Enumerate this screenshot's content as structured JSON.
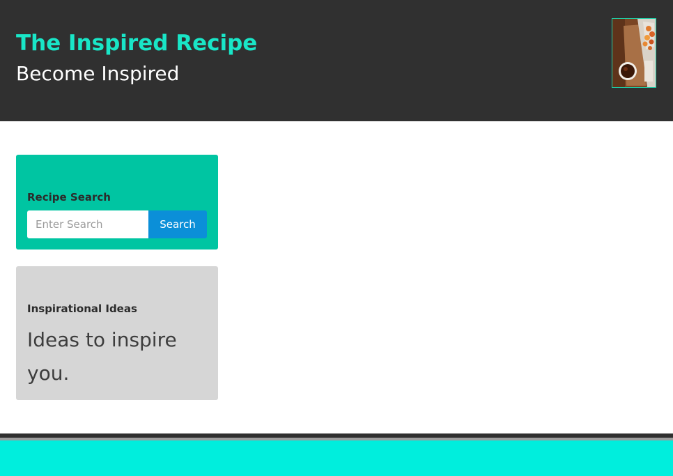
{
  "header": {
    "title": "The Inspired Recipe",
    "subtitle": "Become Inspired",
    "logo_icon": "food-photo-logo"
  },
  "search_panel": {
    "heading": "Recipe Search",
    "input_placeholder": "Enter Search",
    "input_value": "",
    "button_label": "Search"
  },
  "ideas_panel": {
    "heading": "Inspirational Ideas",
    "body": "Ideas to inspire you."
  },
  "colors": {
    "header_bg": "#303030",
    "title_accent": "#19e6c7",
    "search_panel_bg": "#00c5a2",
    "search_button_bg": "#0b8fd8",
    "ideas_panel_bg": "#d6d6d6",
    "footer_accent": "#00eedd"
  }
}
